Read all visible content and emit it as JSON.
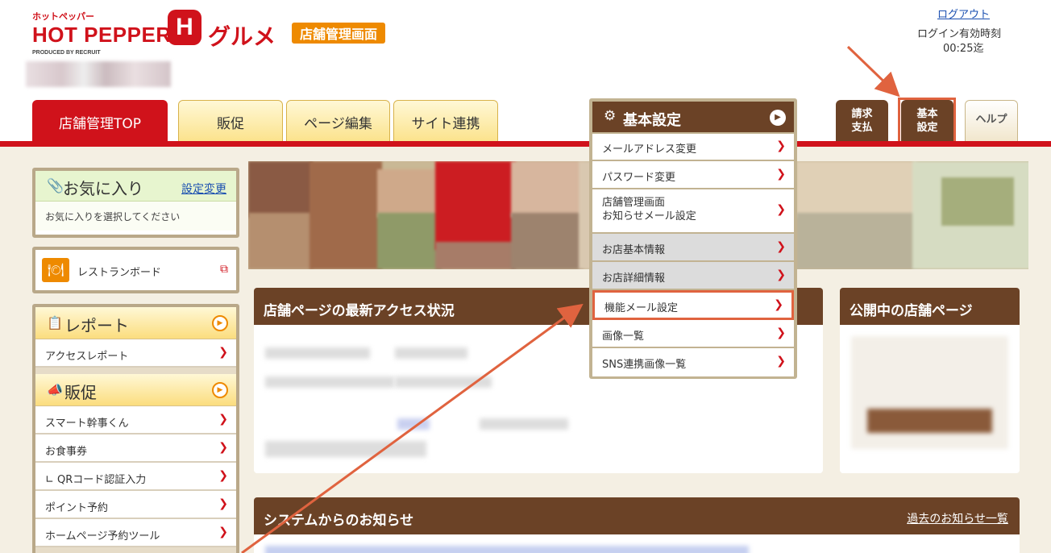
{
  "header": {
    "logo_small": "ホットペッパー",
    "logo_main": "HOT PEPPER",
    "logo_h": "H",
    "logo_gourmet": "グルメ",
    "logo_produced": "PRODUCED BY RECRUIT",
    "admin_badge": "店舗管理画面",
    "logout": "ログアウト",
    "login_time_label": "ログイン有効時刻",
    "login_time": "00:25迄"
  },
  "nav": {
    "tabs": [
      {
        "label": "店舗管理TOP"
      },
      {
        "label": "販促"
      },
      {
        "label": "ページ編集"
      },
      {
        "label": "サイト連携"
      }
    ],
    "billing": "請求\n支払",
    "settings": "基本\n設定",
    "help": "ヘルプ"
  },
  "sidebar": {
    "favorites": {
      "title": "お気に入り",
      "change_link": "設定変更",
      "placeholder": "お気に入りを選択してください"
    },
    "restaurant_board": "レストランボード",
    "report": {
      "title": "レポート",
      "items": [
        "アクセスレポート"
      ]
    },
    "promo": {
      "title": "販促",
      "items": [
        "スマート幹事くん",
        "お食事券",
        "∟ QRコード認証入力",
        "ポイント予約",
        "ホームページ予約ツール"
      ]
    }
  },
  "main": {
    "access_title": "店舗ページの最新アクセス状況",
    "public_title": "公開中の店舗ページ",
    "notice_title": "システムからのお知らせ",
    "notice_link": "過去のお知らせ一覧"
  },
  "dropdown": {
    "title": "基本設定",
    "items": [
      {
        "label": "メールアドレス変更"
      },
      {
        "label": "パスワード変更"
      },
      {
        "label": "店舗管理画面\nお知らせメール設定"
      },
      {
        "label": "お店基本情報"
      },
      {
        "label": "お店詳細情報"
      },
      {
        "label": "機能メール設定"
      },
      {
        "label": "画像一覧"
      },
      {
        "label": "SNS連携画像一覧"
      }
    ]
  },
  "colors": {
    "brand_red": "#d0121b",
    "brown": "#6b4226",
    "accent_orange": "#ee8a00",
    "highlight": "#e0633f"
  }
}
